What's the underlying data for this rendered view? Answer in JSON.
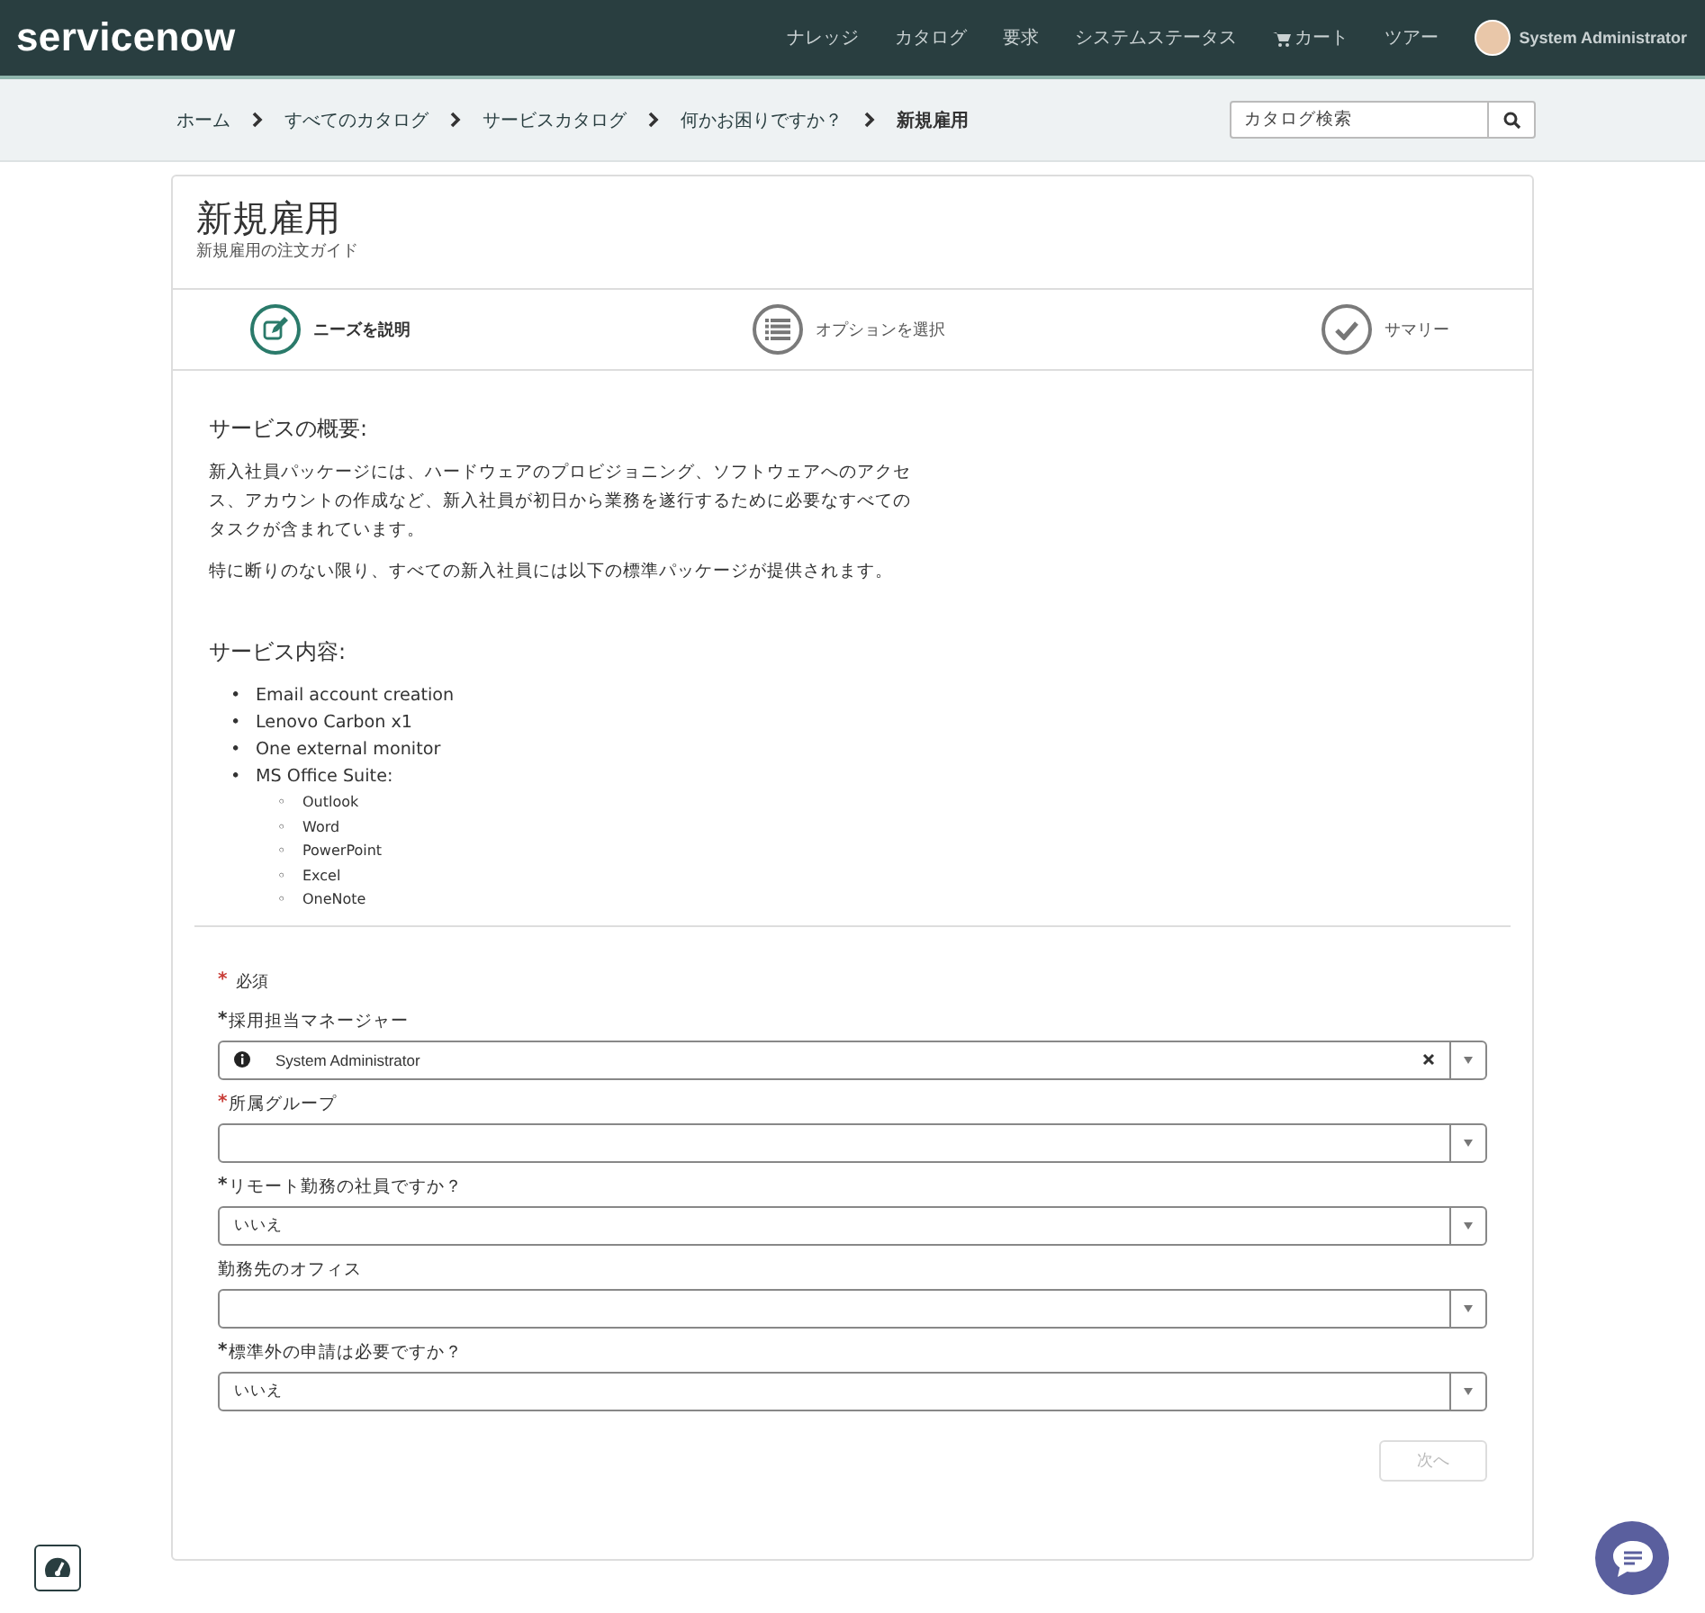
{
  "header": {
    "logo": "servicenow",
    "nav": [
      {
        "label": "ナレッジ",
        "kind": "text"
      },
      {
        "label": "カタログ",
        "kind": "text"
      },
      {
        "label": "要求",
        "kind": "text"
      },
      {
        "label": "システムステータス",
        "kind": "text"
      },
      {
        "label": "カート",
        "kind": "cart"
      },
      {
        "label": "ツアー",
        "kind": "text"
      }
    ],
    "user": "System Administrator"
  },
  "breadcrumbs": [
    {
      "label": "ホーム",
      "current": false
    },
    {
      "label": "すべてのカタログ",
      "current": false
    },
    {
      "label": "サービスカタログ",
      "current": false
    },
    {
      "label": "何かお困りですか？",
      "current": false
    },
    {
      "label": "新規雇用",
      "current": true
    }
  ],
  "search": {
    "placeholder": "カタログ検索"
  },
  "card": {
    "title": "新規雇用",
    "subtitle": "新規雇用の注文ガイド"
  },
  "steps": [
    {
      "label": "ニーズを説明",
      "kind": "edit",
      "selected": true
    },
    {
      "label": "オプションを選択",
      "kind": "list",
      "selected": false
    },
    {
      "label": "サマリー",
      "kind": "check",
      "selected": false
    }
  ],
  "description": {
    "heading": "サービスの概要:",
    "paragraphs": [
      "新入社員パッケージには、ハードウェアのプロビジョニング、ソフトウェアへのアクセス、アカウントの作成など、新入社員が初日から業務を遂行するために必要なすべてのタスクが含まれています。",
      "特に断りのない限り、すべての新入社員には以下の標準パッケージが提供されます。"
    ],
    "list_heading": "サービス内容:",
    "items": [
      {
        "bullet": "•",
        "label": "Email account creation"
      },
      {
        "bullet": "•",
        "label": "Lenovo Carbon x1"
      },
      {
        "bullet": "•",
        "label": "One external monitor"
      },
      {
        "bullet": "•",
        "label": "MS Office Suite:",
        "children": [
          {
            "bullet": "◦",
            "label": "Outlook"
          },
          {
            "bullet": "◦",
            "label": "Word"
          },
          {
            "bullet": "◦",
            "label": "PowerPoint"
          },
          {
            "bullet": "◦",
            "label": "Excel"
          },
          {
            "bullet": "◦",
            "label": "OneNote"
          }
        ]
      }
    ]
  },
  "required_note": {
    "mark": "*",
    "label": "必須"
  },
  "fields": [
    {
      "label": "採用担当マネージャー",
      "required_mark": "*",
      "color": "#333333",
      "value": "System Administrator",
      "kind": "reference"
    },
    {
      "label": "所属グループ",
      "required_mark": "*",
      "color": "#c83c36",
      "kind": "select"
    },
    {
      "label": "リモート勤務の社員ですか？",
      "required_mark": "*",
      "color": "#333333",
      "value": "いいえ",
      "kind": "select"
    },
    {
      "label": "勤務先のオフィス",
      "kind": "select"
    },
    {
      "label": "標準外の申請は必要ですか？",
      "required_mark": "*",
      "color": "#333333",
      "value": "いいえ",
      "kind": "select"
    }
  ],
  "next_button": {
    "label": "次へ",
    "disabled": true
  }
}
